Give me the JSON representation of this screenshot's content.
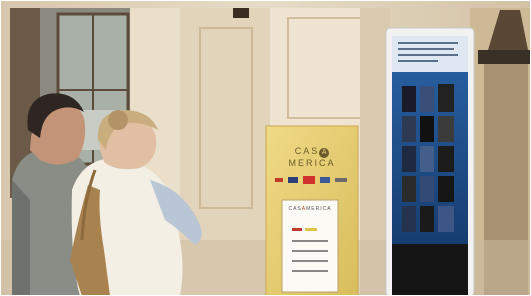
{
  "sign": {
    "brand_left": "CAS",
    "brand_letter": "A",
    "brand_right": "MERICA",
    "inner_brand_left": "CAS",
    "inner_brand_letter": "A",
    "inner_brand_right": "MERICA"
  },
  "colors": {
    "wall": "#e4d6bf",
    "sign_panel": "#e9d27a",
    "kiosk_frame": "#f2f2f2",
    "kiosk_screen": "#1e4f8a",
    "accent_red": "#d0312d"
  }
}
